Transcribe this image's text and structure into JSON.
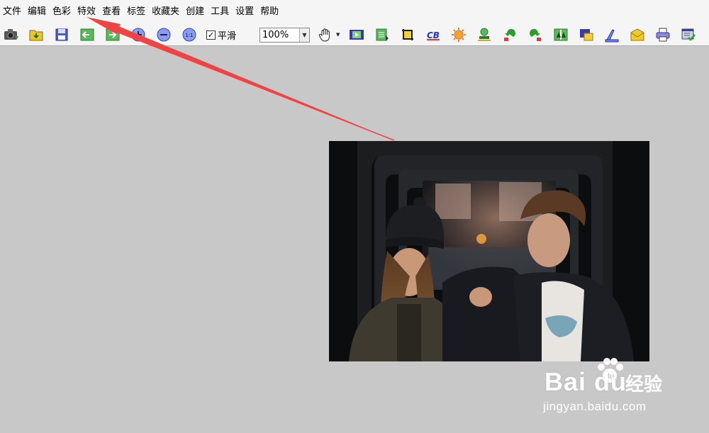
{
  "menu": [
    "文件",
    "编辑",
    "色彩",
    "特效",
    "查看",
    "标签",
    "收藏夹",
    "创建",
    "工具",
    "设置",
    "帮助"
  ],
  "toolbar": {
    "smooth_label": "平滑",
    "smooth_checked": true,
    "zoom_value": "100%",
    "icons": [
      "camera-icon",
      "open-folder-icon",
      "save-icon",
      "previous-icon",
      "next-icon",
      "zoom-in-icon",
      "zoom-out-icon",
      "actual-size-icon",
      "hand-icon",
      "slideshow-icon",
      "thumbnail-icon",
      "crop-icon",
      "color-balance-icon",
      "brightness-icon",
      "stamp-icon",
      "rotate-left-icon",
      "rotate-right-icon",
      "flip-icon",
      "resize-icon",
      "scan-icon",
      "email-icon",
      "print-icon",
      "batch-icon"
    ]
  },
  "watermark": {
    "logo": "Bai du",
    "brand_cn": "经验",
    "url": "jingyan.baidu.com"
  },
  "annotation": {
    "color": "#f04444"
  }
}
